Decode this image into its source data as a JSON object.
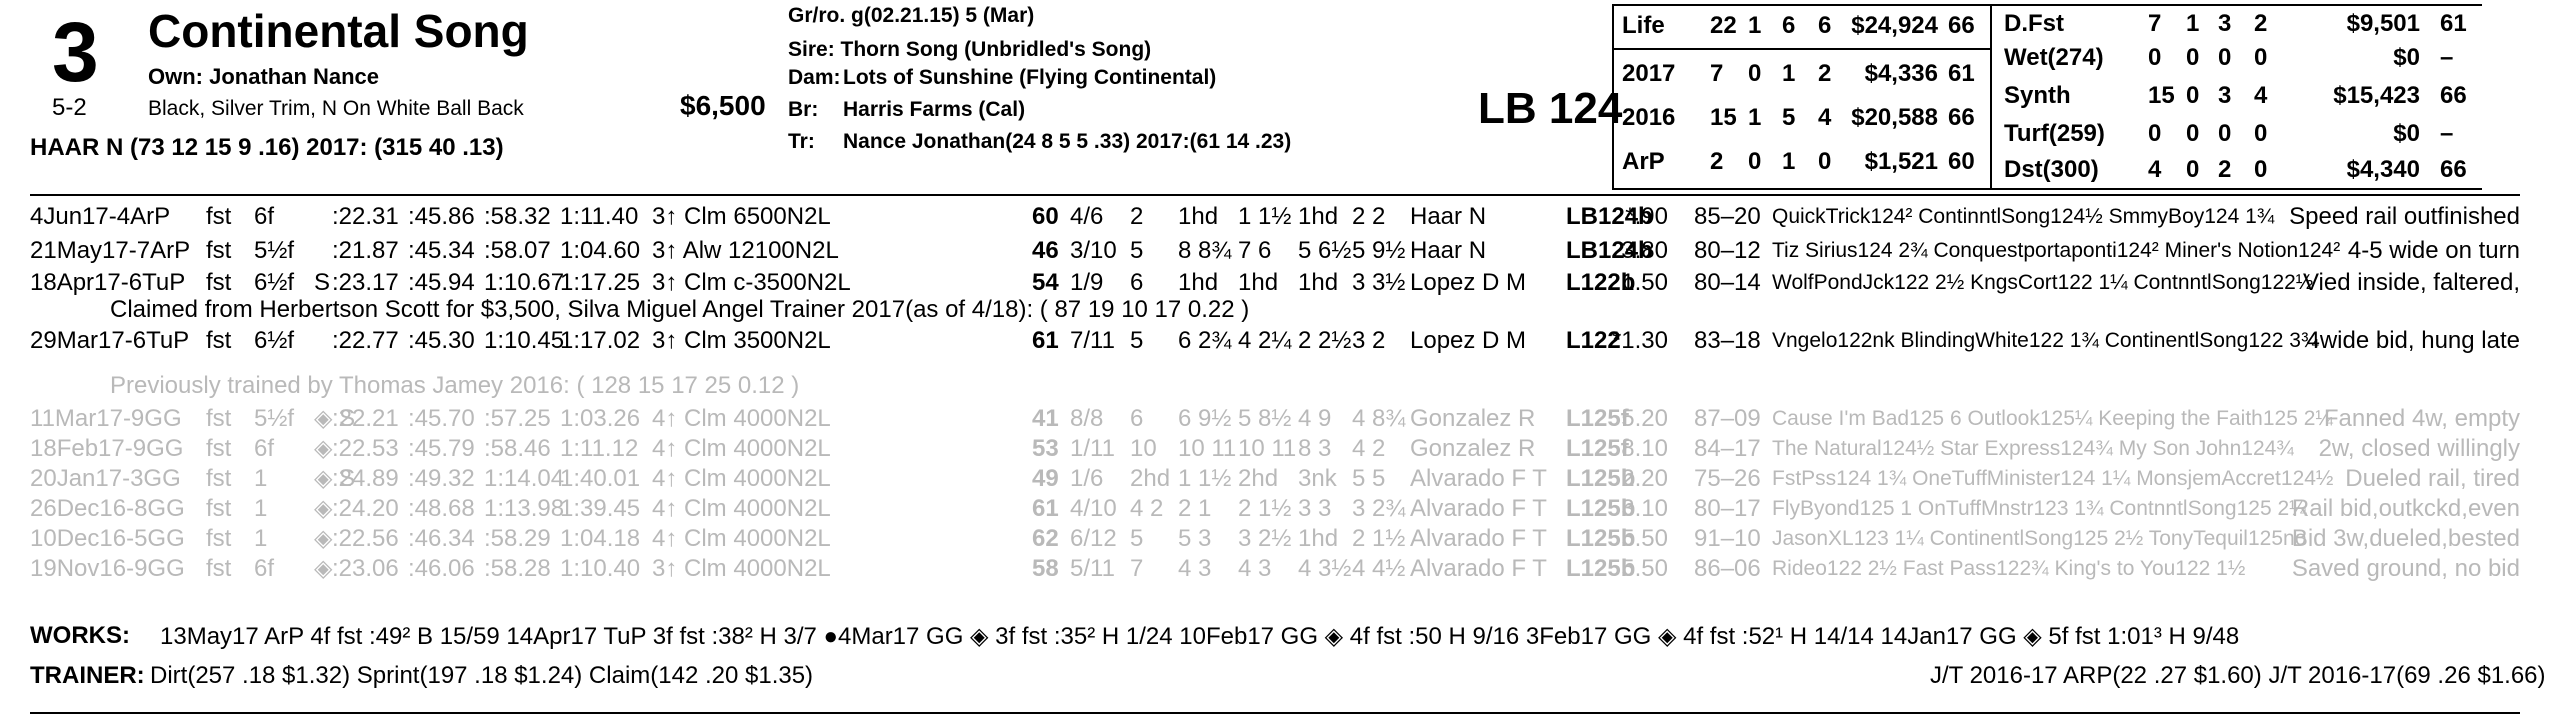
{
  "horse": {
    "number": "3",
    "name": "Continental Song",
    "owner": "Own: Jonathan Nance",
    "odds": "5-2",
    "silks": "Black, Silver Trim, N On White Ball Back",
    "price": "$6,500",
    "jockey_line": "HAAR N (73 12 15 9 .16) 2017: (315 40 .13)"
  },
  "pedigree": {
    "grro": "Gr/ro. g(02.21.15) 5 (Mar)",
    "sire": "Sire: Thorn Song (Unbridled's Song)",
    "dam_label": "Dam:",
    "dam": "Lots of Sunshine (Flying Continental)",
    "br_label": "Br:",
    "br": "Harris Farms (Cal)",
    "tr_label": "Tr:",
    "tr": "Nance Jonathan(24 8 5 5 .33) 2017:(61 14 .23)"
  },
  "weight": "LB 124",
  "life_stats": [
    {
      "label": "Life",
      "starts": "22",
      "w": "1",
      "p": "6",
      "s": "6",
      "earn": "$24,924",
      "spd": "66"
    },
    {
      "label": "2017",
      "starts": "7",
      "w": "0",
      "p": "1",
      "s": "2",
      "earn": "$4,336",
      "spd": "61"
    },
    {
      "label": "2016",
      "starts": "15",
      "w": "1",
      "p": "5",
      "s": "4",
      "earn": "$20,588",
      "spd": "66"
    },
    {
      "label": "ArP",
      "starts": "2",
      "w": "0",
      "p": "1",
      "s": "0",
      "earn": "$1,521",
      "spd": "60"
    }
  ],
  "surface_stats": [
    {
      "label": "D.Fst",
      "starts": "7",
      "w": "1",
      "p": "3",
      "s": "2",
      "earn": "$9,501",
      "spd": "61"
    },
    {
      "label": "Wet(274)",
      "starts": "0",
      "w": "0",
      "p": "0",
      "s": "0",
      "earn": "$0",
      "spd": "–"
    },
    {
      "label": "Synth",
      "starts": "15",
      "w": "0",
      "p": "3",
      "s": "4",
      "earn": "$15,423",
      "spd": "66"
    },
    {
      "label": "Turf(259)",
      "starts": "0",
      "w": "0",
      "p": "0",
      "s": "0",
      "earn": "$0",
      "spd": "–"
    },
    {
      "label": "Dst(300)",
      "starts": "4",
      "w": "0",
      "p": "2",
      "s": "0",
      "earn": "$4,340",
      "spd": "66"
    }
  ],
  "races": [
    {
      "date": "4Jun17-4ArP",
      "cond": "fst",
      "dist": "6f",
      "s": "",
      "f1": ":22.31",
      "f2": ":45.86",
      "f3": ":58.32",
      "f4": "1:11.40",
      "cls": "3↑ Clm 6500N2L",
      "spd": "60",
      "pp": "4/6",
      "st": "2",
      "c1": "1hd",
      "c2": "1 1½",
      "str": "1hd",
      "fin": "2 2",
      "jockey": "Haar N",
      "med": "LB124b",
      "odds": "*.90",
      "pace": "85–20",
      "comp": "QuickTrick124² ContinntlSong124½ SmmyBoy124 1¾",
      "comment": "Speed rail outfinished",
      "grey": false
    },
    {
      "date": "21May17-7ArP",
      "cond": "fst",
      "dist": "5½f",
      "s": "",
      "f1": ":21.87",
      "f2": ":45.34",
      "f3": ":58.07",
      "f4": "1:04.60",
      "cls": "3↑ Alw 12100N2L",
      "spd": "46",
      "pp": "3/10",
      "st": "5",
      "c1": "8 8¾",
      "c2": "7 6",
      "str": "5 6½",
      "fin": "5 9½",
      "jockey": "Haar N",
      "med": "LB124b",
      "odds": "3.80",
      "pace": "80–12",
      "comp": "Tiz Sirius124 2¾ Conquestportaponti124² Miner's Notion124²",
      "comment": "4-5 wide on turn",
      "grey": false
    },
    {
      "date": "18Apr17-6TuP",
      "cond": "fst",
      "dist": "6½f",
      "s": "S",
      "f1": ":23.17",
      "f2": ":45.94",
      "f3": "1:10.67",
      "f4": "1:17.25",
      "cls": "3↑ Clm c-3500N2L",
      "spd": "54",
      "pp": "1/9",
      "st": "6",
      "c1": "1hd",
      "c2": "1hd",
      "str": "1hd",
      "fin": "3 3½",
      "jockey": "Lopez D M",
      "med": "L122b",
      "odds": "1.50",
      "pace": "80–14",
      "comp": "WolfPondJck122 2½ KngsCort122 1¼ ContnntlSong122½",
      "comment": "Vied inside, faltered,",
      "grey": false
    },
    {
      "date": "29Mar17-6TuP",
      "cond": "fst",
      "dist": "6½f",
      "s": "",
      "f1": ":22.77",
      "f2": ":45.30",
      "f3": "1:10.45",
      "f4": "1:17.02",
      "cls": "3↑ Clm 3500N2L",
      "spd": "61",
      "pp": "7/11",
      "st": "5",
      "c1": "6 2¾",
      "c2": "4 2¼",
      "str": "2 2½",
      "fin": "3 2",
      "jockey": "Lopez D M",
      "med": "L122",
      "odds": "*1.30",
      "pace": "83–18",
      "comp": "Vngelo122nk BlindingWhite122 1¾ ContinentlSong122 3¾",
      "comment": "4wide bid, hung late",
      "grey": false
    },
    {
      "date": "11Mar17-9GG",
      "cond": "fst",
      "dist": "5½f",
      "s": "◈ S",
      "f1": ":22.21",
      "f2": ":45.70",
      "f3": ":57.25",
      "f4": "1:03.26",
      "cls": "4↑ Clm 4000N2L",
      "spd": "41",
      "pp": "8/8",
      "st": "6",
      "c1": "6 9½",
      "c2": "5 8½",
      "str": "4 9",
      "fin": "4 8¾",
      "jockey": "Gonzalez R",
      "med": "L125f",
      "odds": "5.20",
      "pace": "87–09",
      "comp": "Cause I'm Bad125 6 Outlook125¼ Keeping the Faith125 2¼",
      "comment": "Fanned 4w, empty",
      "grey": true
    },
    {
      "date": "18Feb17-9GG",
      "cond": "fst",
      "dist": "6f",
      "s": "◈",
      "f1": ":22.53",
      "f2": ":45.79",
      "f3": ":58.46",
      "f4": "1:11.12",
      "cls": "4↑ Clm 4000N2L",
      "spd": "53",
      "pp": "1/11",
      "st": "10",
      "c1": "10 11",
      "c2": "10 11",
      "str": "8 3",
      "fin": "4 2",
      "jockey": "Gonzalez R",
      "med": "L125f",
      "odds": "8.10",
      "pace": "84–17",
      "comp": "The Natural124½ Star Express124¾ My Son John124¾",
      "comment": "2w, closed willingly",
      "grey": true
    },
    {
      "date": "20Jan17-3GG",
      "cond": "fst",
      "dist": "1",
      "s": "◈ S",
      "f1": ":24.89",
      "f2": ":49.32",
      "f3": "1:14.04",
      "f4": "1:40.01",
      "cls": "4↑ Clm 4000N2L",
      "spd": "49",
      "pp": "1/6",
      "st": "2hd",
      "c1": "1 1½",
      "c2": "2hd",
      "str": "3nk",
      "fin": "5 5",
      "jockey": "Alvarado F T",
      "med": "L125b",
      "odds": "2.20",
      "pace": "75–26",
      "comp": "FstPss124 1¾ OneTuffMinister124 1¼ MonsjemAccret124½",
      "comment": "Dueled rail, tired",
      "grey": true
    },
    {
      "date": "26Dec16-8GG",
      "cond": "fst",
      "dist": "1",
      "s": "◈",
      "f1": ":24.20",
      "f2": ":48.68",
      "f3": "1:13.98",
      "f4": "1:39.45",
      "cls": "4↑ Clm 4000N2L",
      "spd": "61",
      "pp": "4/10",
      "st": "4 2",
      "c1": "2 1",
      "c2": "2 1½",
      "str": "3 3",
      "fin": "3 2¾",
      "jockey": "Alvarado F T",
      "med": "L125b",
      "odds": "3.10",
      "pace": "80–17",
      "comp": "FlyByond125 1 OnTuffMnstr123 1¾ ContnntlSong125 2¼",
      "comment": "Rail bid,outkckd,even",
      "grey": true
    },
    {
      "date": "10Dec16-5GG",
      "cond": "fst",
      "dist": "1",
      "s": "◈",
      "f1": ":22.56",
      "f2": ":46.34",
      "f3": ":58.29",
      "f4": "1:04.18",
      "cls": "4↑ Clm 4000N2L",
      "spd": "62",
      "pp": "6/12",
      "st": "5",
      "c1": "5 3",
      "c2": "3 2½",
      "str": "1hd",
      "fin": "2 1½",
      "jockey": "Alvarado F T",
      "med": "L125b",
      "odds": "5.50",
      "pace": "91–10",
      "comp": "JasonXL123 1¼ ContinentlSong125 2½ TonyTequil125no",
      "comment": "Bid 3w,dueled,bested",
      "grey": true
    },
    {
      "date": "19Nov16-9GG",
      "cond": "fst",
      "dist": "6f",
      "s": "◈",
      "f1": ":23.06",
      "f2": ":46.06",
      "f3": ":58.28",
      "f4": "1:10.40",
      "cls": "3↑ Clm 4000N2L",
      "spd": "58",
      "pp": "5/11",
      "st": "7",
      "c1": "4 3",
      "c2": "4 3",
      "str": "4 3½",
      "fin": "4 4½",
      "jockey": "Alvarado F T",
      "med": "L125b",
      "odds": "5.50",
      "pace": "86–06",
      "comp": "Rideo122 2½ Fast Pass122¾ King's to You122 1½",
      "comment": "Saved ground, no bid",
      "grey": true
    }
  ],
  "claimed_note": "Claimed from Herbertson Scott for $3,500, Silva Miguel Angel Trainer 2017(as of 4/18): ( 87 19 10 17 0.22 )",
  "prev_trained_note": "Previously trained by Thomas Jamey 2016: ( 128 15 17 25 0.12 )",
  "works_label": "WORKS:",
  "works": "13May17 ArP 4f fst :49² B 15/59   14Apr17 TuP 3f fst :38² H 3/7   ●4Mar17 GG ◈ 3f fst :35² H 1/24   10Feb17 GG ◈ 4f fst :50 H 9/16   3Feb17 GG ◈ 4f fst :52¹ H 14/14   14Jan17 GG ◈ 5f fst 1:01³ H 9/48",
  "trainer_label": "TRAINER:",
  "trainer": "Dirt(257 .18 $1.32) Sprint(197 .18 $1.24) Claim(142 .20 $1.35)",
  "jt_stats": "J/T 2016-17 ARP(22 .27 $1.60) J/T 2016-17(69 .26 $1.66)"
}
